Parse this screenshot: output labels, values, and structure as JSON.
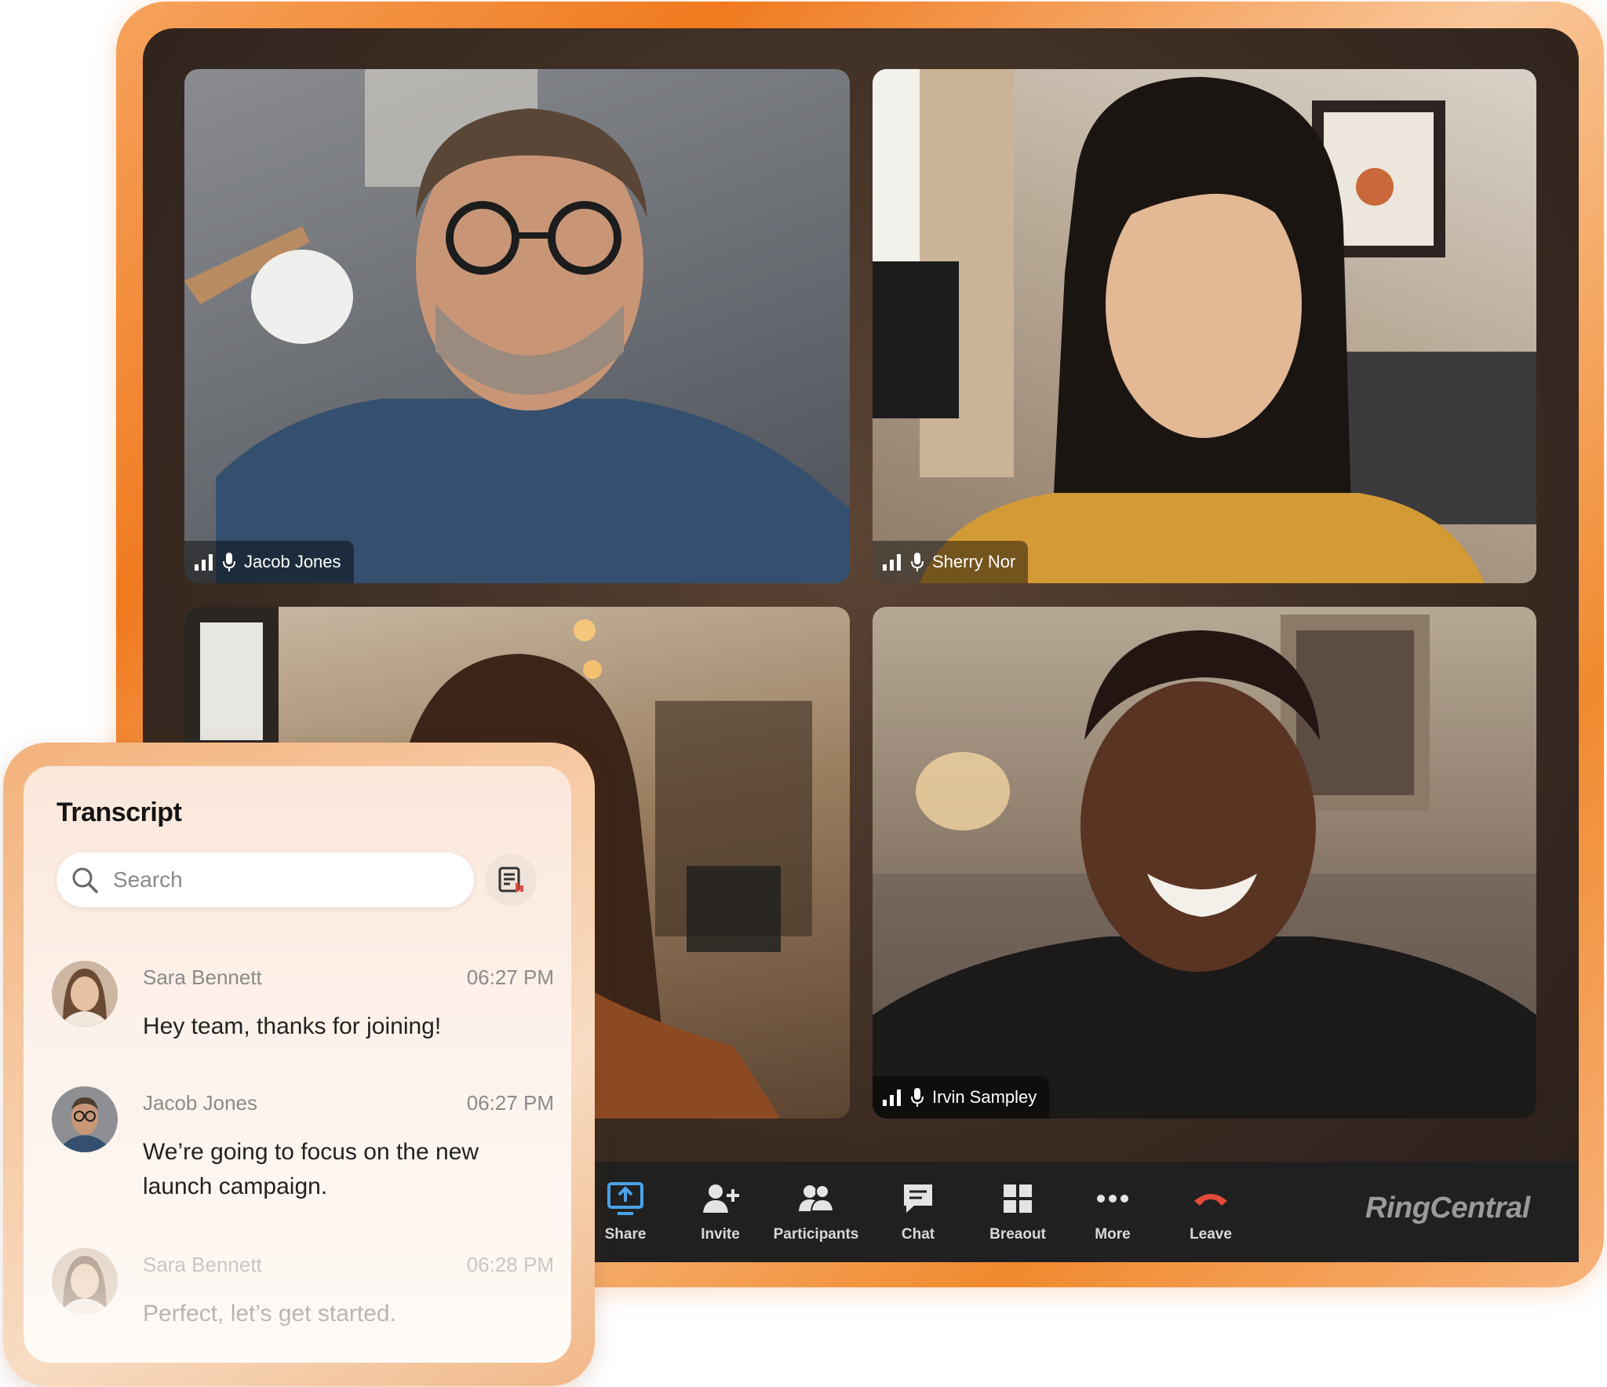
{
  "participants": [
    {
      "name": "Jacob Jones"
    },
    {
      "name": "Sherry Nor"
    },
    {
      "name": ""
    },
    {
      "name": "Irvin Sampley"
    }
  ],
  "toolbar": {
    "items": [
      {
        "label": "Share",
        "icon": "share-screen-icon"
      },
      {
        "label": "Invite",
        "icon": "add-person-icon"
      },
      {
        "label": "Participants",
        "icon": "participants-icon"
      },
      {
        "label": "Chat",
        "icon": "chat-icon"
      },
      {
        "label": "Breaout",
        "icon": "breakout-grid-icon"
      },
      {
        "label": "More",
        "icon": "more-dots-icon"
      },
      {
        "label": "Leave",
        "icon": "hang-up-icon"
      }
    ],
    "brand": "RingCentral",
    "colors": {
      "share_active": "#4aa3e8",
      "leave": "#e24a3b",
      "bar": "#202020"
    }
  },
  "transcript": {
    "title": "Transcript",
    "search_placeholder": "Search",
    "messages": [
      {
        "sender": "Sara Bennett",
        "time": "06:27 PM",
        "text": "Hey team, thanks for joining!"
      },
      {
        "sender": "Jacob Jones",
        "time": "06:27 PM",
        "text": "We’re going to focus on the new launch campaign."
      },
      {
        "sender": "Sara Bennett",
        "time": "06:28 PM",
        "text": "Perfect, let’s get started."
      }
    ]
  },
  "colors": {
    "frame_accent": "#f07a1f",
    "window_bg": "#3a2b22"
  }
}
